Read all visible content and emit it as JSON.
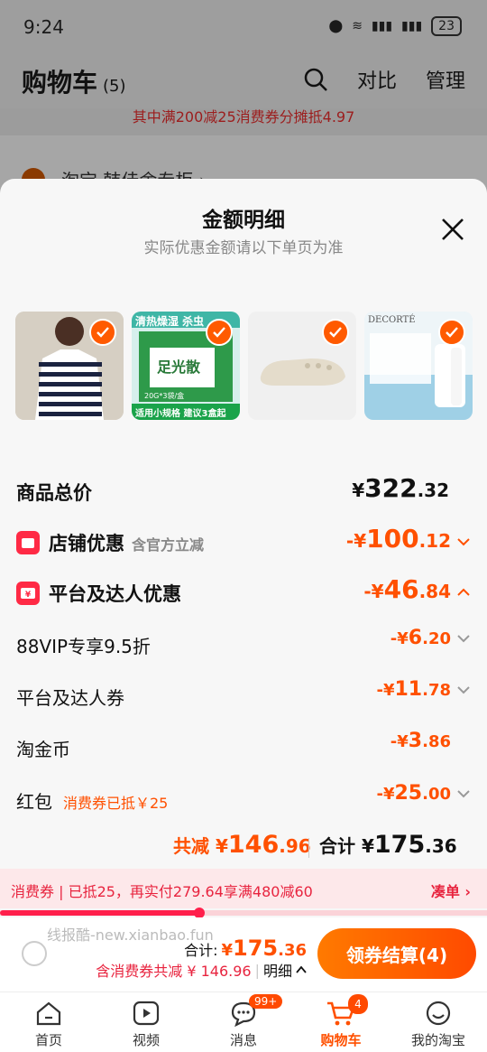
{
  "status_bar": {
    "time": "9:24",
    "battery": "23"
  },
  "bg": {
    "title": "购物车",
    "count": "(5)",
    "compare": "对比",
    "manage": "管理",
    "coupon_notice": "其中满200减25消费券分摊抵4.97",
    "store_label": "淘宝  韩佳舍专柜 ›"
  },
  "sheet": {
    "title": "金额明细",
    "subtitle": "实际优惠金额请以下单页为准"
  },
  "products": [
    {
      "name": "striped t-shirt",
      "selected": true
    },
    {
      "name": "足光散",
      "text1": "清热燥湿 杀虫",
      "text2": "足光散",
      "text3": "20G*3袋/盒",
      "text4": "适用小规格 建议3盒起",
      "selected": true
    },
    {
      "name": "white clog",
      "selected": true
    },
    {
      "name": "DECORTÉ sunscreen",
      "brand": "DECORTÉ",
      "selected": true
    }
  ],
  "breakdown": {
    "total": {
      "label": "商品总价",
      "currency": "¥",
      "int": "322",
      "dec": ".32"
    },
    "store_discount": {
      "label": "店铺优惠",
      "note": "含官方立减",
      "prefix": "-¥",
      "int": "100",
      "dec": ".12"
    },
    "platform_discount": {
      "label": "平台及达人优惠",
      "prefix": "-¥",
      "int": "46",
      "dec": ".84"
    },
    "vip": {
      "label": "88VIP专享9.5折",
      "prefix": "-¥",
      "int": "6",
      "dec": ".20"
    },
    "coupon": {
      "label": "平台及达人券",
      "prefix": "-¥",
      "int": "11",
      "dec": ".78"
    },
    "coins": {
      "label": "淘金币",
      "prefix": "-¥",
      "int": "3",
      "dec": ".86"
    },
    "redpacket": {
      "label": "红包",
      "note": "消费券已抵￥25",
      "prefix": "-¥",
      "int": "25",
      "dec": ".00"
    }
  },
  "summary": {
    "reduce_label": "共减",
    "reduce_currency": "¥",
    "reduce_int": "146",
    "reduce_dec": ".96",
    "total_label": "合计",
    "total_currency": "¥",
    "total_int": "175",
    "total_dec": ".36"
  },
  "promo": {
    "text": "消费券 | 已抵25，再实付279.64享满480减60",
    "action": "凑单 ›",
    "progress": 0.41
  },
  "checkout": {
    "watermark": "线报酷-new.xianbao.fun",
    "total_label": "合计:",
    "total_currency": "¥",
    "total_int": "175",
    "total_dec": ".36",
    "discount_text": "含消费券共减 ¥ 146.96",
    "detail_link": "明细",
    "pay_button": "领券结算(4)"
  },
  "tabs": [
    {
      "label": "首页",
      "icon": "home-icon"
    },
    {
      "label": "视频",
      "icon": "video-icon"
    },
    {
      "label": "消息",
      "icon": "message-icon",
      "badge": "99+"
    },
    {
      "label": "购物车",
      "icon": "cart-icon",
      "badge": "4",
      "active": true
    },
    {
      "label": "我的淘宝",
      "icon": "profile-icon"
    }
  ],
  "colors": {
    "accent": "#ff5000",
    "promo_red": "#e8243f"
  }
}
